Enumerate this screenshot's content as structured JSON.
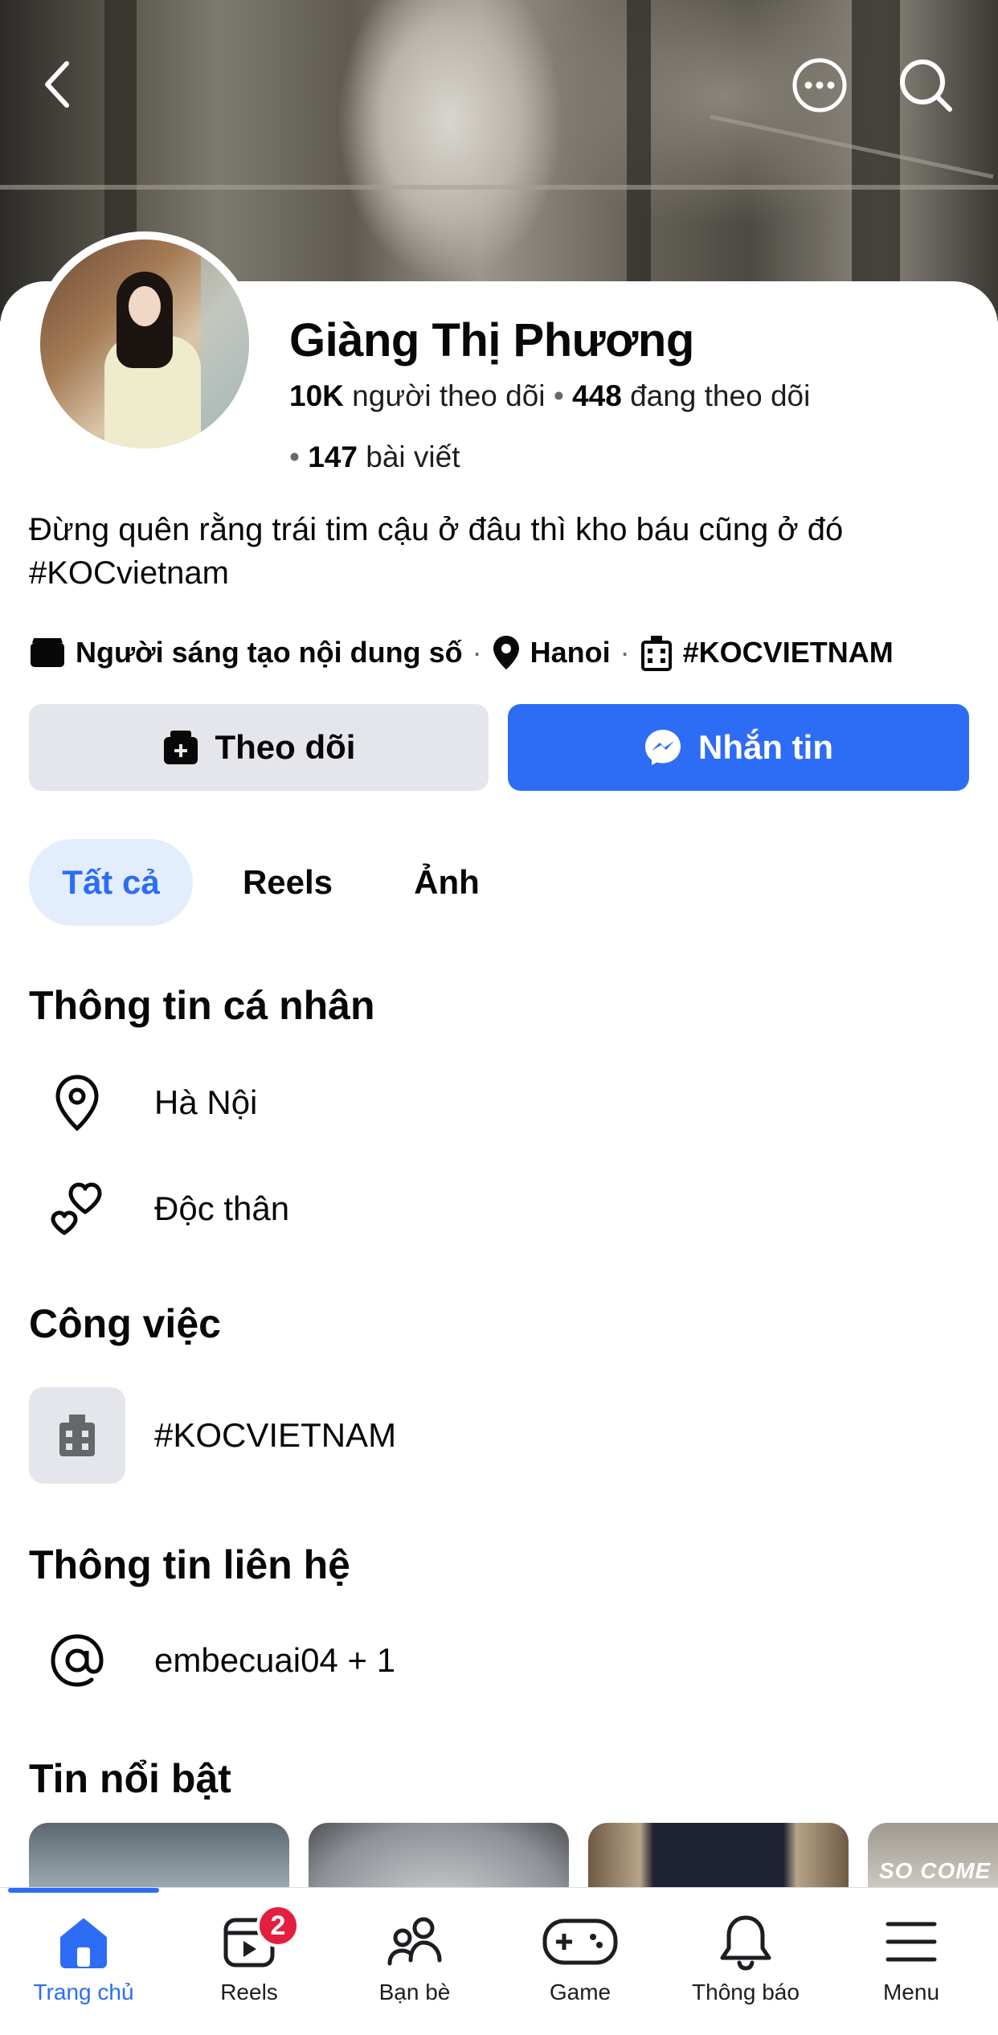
{
  "profile": {
    "name": "Giàng Thị Phương",
    "followers_count": "10K",
    "followers_label": "người theo dõi",
    "following_count": "448",
    "following_label": "đang theo dõi",
    "posts_count": "147",
    "posts_label": "bài viết",
    "bio_line1": "Đừng quên rằng trái tim cậu ở đâu thì kho báu cũng ở đó",
    "bio_line2": "#KOCvietnam",
    "category": "Người sáng tạo nội dung số",
    "location": "Hanoi",
    "workplace": "#KOCVIETNAM"
  },
  "actions": {
    "follow_label": "Theo dõi",
    "message_label": "Nhắn tin"
  },
  "tabs": [
    {
      "label": "Tất cả",
      "active": true
    },
    {
      "label": "Reels",
      "active": false
    },
    {
      "label": "Ảnh",
      "active": false
    }
  ],
  "personal_info": {
    "title": "Thông tin cá nhân",
    "items": [
      {
        "icon": "location-pin-icon",
        "text": "Hà Nội"
      },
      {
        "icon": "hearts-icon",
        "text": "Độc thân"
      }
    ]
  },
  "work": {
    "title": "Công việc",
    "items": [
      {
        "icon": "building-icon",
        "text": "#KOCVIETNAM"
      }
    ]
  },
  "contact": {
    "title": "Thông tin liên hệ",
    "items": [
      {
        "icon": "at-icon",
        "text": "embecuai04 + 1"
      }
    ]
  },
  "highlights": {
    "title": "Tin nổi bật",
    "items": [
      {
        "caption": ""
      },
      {
        "caption": ""
      },
      {
        "caption": ""
      },
      {
        "caption": "SO COME"
      }
    ]
  },
  "bottom_nav": [
    {
      "label": "Trang chủ",
      "icon": "home-icon",
      "active": true
    },
    {
      "label": "Reels",
      "icon": "reels-icon",
      "badge": "2"
    },
    {
      "label": "Bạn bè",
      "icon": "friends-icon"
    },
    {
      "label": "Game",
      "icon": "gamepad-icon"
    },
    {
      "label": "Thông báo",
      "icon": "bell-icon"
    },
    {
      "label": "Menu",
      "icon": "menu-icon"
    }
  ],
  "colors": {
    "primary": "#2d6cf5",
    "badge": "#e41e3f",
    "secondary_button": "#e4e6eb",
    "active_tab_bg": "#e3eefc"
  }
}
